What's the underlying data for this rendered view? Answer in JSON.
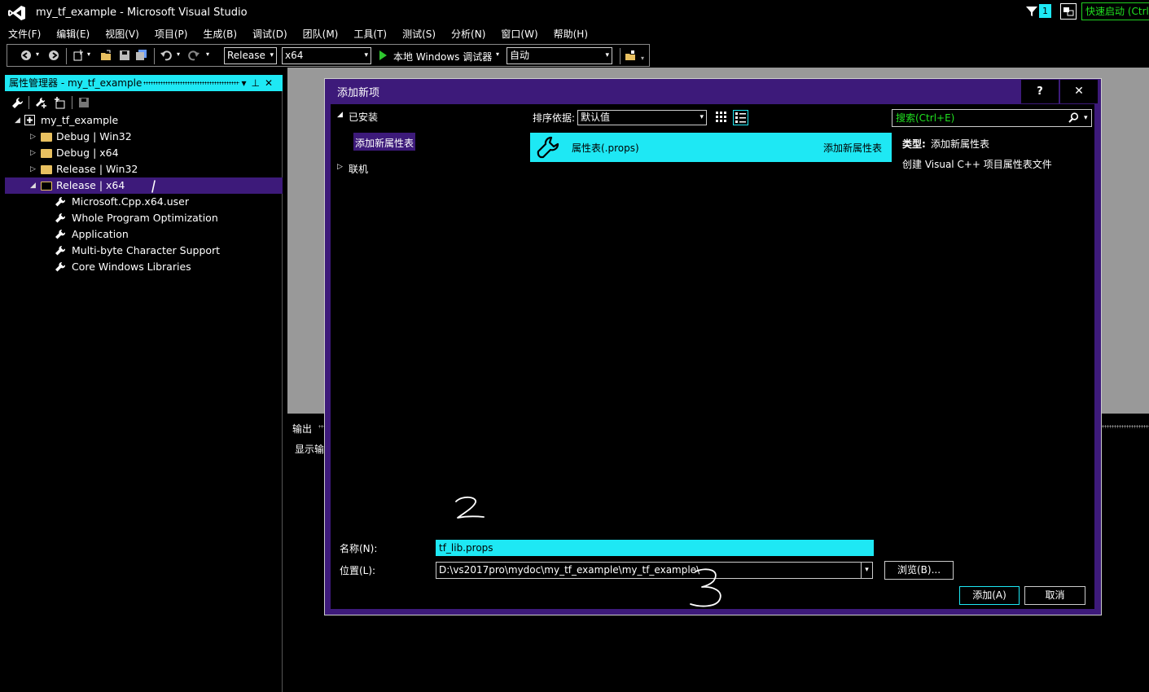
{
  "window": {
    "title": "my_tf_example - Microsoft Visual Studio",
    "notification_count": "1",
    "quick_launch": "快速启动 (Ctrl"
  },
  "menu": [
    "文件(F)",
    "编辑(E)",
    "视图(V)",
    "项目(P)",
    "生成(B)",
    "调试(D)",
    "团队(M)",
    "工具(T)",
    "测试(S)",
    "分析(N)",
    "窗口(W)",
    "帮助(H)"
  ],
  "toolbar": {
    "configuration": "Release",
    "platform": "x64",
    "run_target": "本地 Windows 调试器",
    "run_mode": "自动"
  },
  "property_manager": {
    "title": "属性管理器 - my_tf_example",
    "project": "my_tf_example",
    "configs": [
      {
        "label": "Debug | Win32"
      },
      {
        "label": "Debug | x64"
      },
      {
        "label": "Release | Win32"
      },
      {
        "label": "Release | x64"
      }
    ],
    "sheets": [
      "Microsoft.Cpp.x64.user",
      "Whole Program Optimization",
      "Application",
      "Multi-byte Character Support",
      "Core Windows Libraries"
    ]
  },
  "output": {
    "title": "输出",
    "show_output_from": "显示输"
  },
  "dialog": {
    "title": "添加新项",
    "help": "?",
    "close": "✕",
    "nav": {
      "installed": "已安装",
      "add_property_sheet": "添加新属性表",
      "online": "联机"
    },
    "sort_label": "排序依据:",
    "sort_value": "默认值",
    "search_placeholder": "搜索(Ctrl+E)",
    "template": {
      "name": "属性表(.props)",
      "category": "添加新属性表"
    },
    "details": {
      "type_label": "类型:",
      "type_value": "添加新属性表",
      "description": "创建 Visual C++ 项目属性表文件"
    },
    "name_label": "名称(N):",
    "name_value": "tf_lib.props",
    "location_label": "位置(L):",
    "location_value": "D:\\vs2017pro\\mydoc\\my_tf_example\\my_tf_example\\",
    "browse": "浏览(B)...",
    "add": "添加(A)",
    "cancel": "取消"
  },
  "colors": {
    "accent_cyan": "#1ee8f4",
    "selection_purple": "#3d1a7a",
    "quicklaunch_green": "#20e020"
  }
}
